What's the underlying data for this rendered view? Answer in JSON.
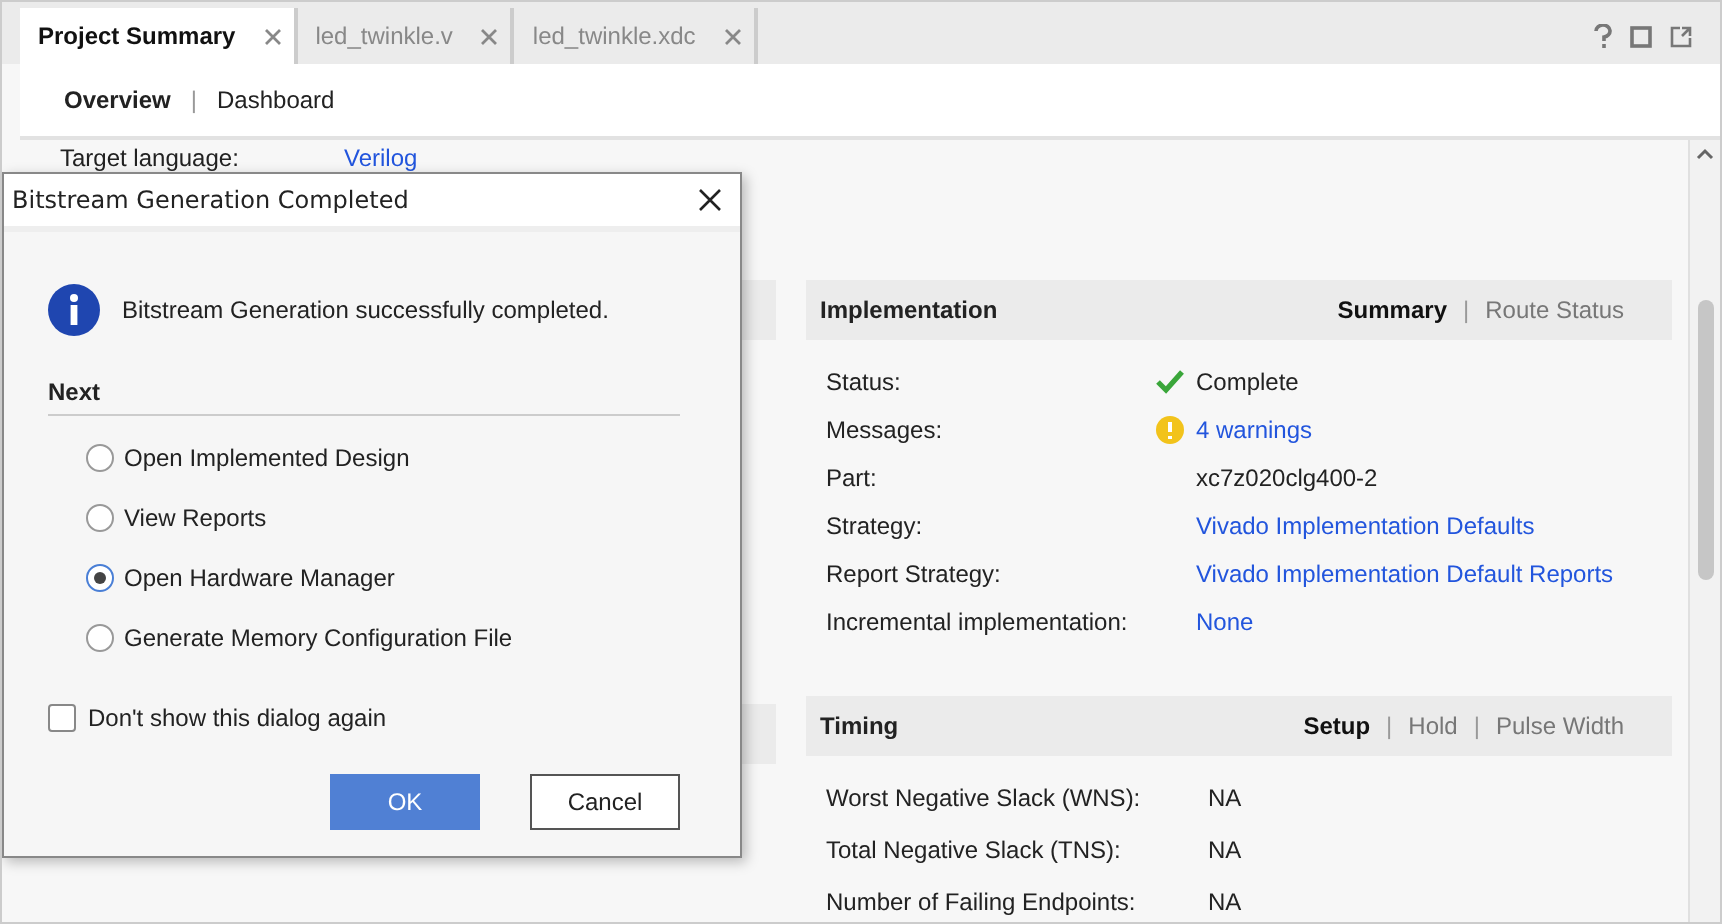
{
  "tabs": [
    {
      "label": "Project Summary",
      "selected": true
    },
    {
      "label": "led_twinkle.v",
      "selected": false
    },
    {
      "label": "led_twinkle.xdc",
      "selected": false
    }
  ],
  "sub_tabs": [
    {
      "label": "Overview",
      "selected": true
    },
    {
      "label": "Dashboard",
      "selected": false
    }
  ],
  "sub_tab_separators": [
    "|"
  ],
  "settings_row": {
    "label": "Target language:",
    "value": "Verilog"
  },
  "implementation": {
    "title": "Implementation",
    "separators": [
      "|"
    ],
    "views": [
      {
        "label": "Summary",
        "selected": true
      },
      {
        "label": "Route Status",
        "selected": false
      }
    ],
    "rows": [
      {
        "label": "Status:",
        "value": "Complete",
        "kind": "ok"
      },
      {
        "label": "Messages:",
        "value": "4 warnings",
        "kind": "warning"
      },
      {
        "label": "Part:",
        "value": "xc7z020clg400-2",
        "kind": "plain"
      },
      {
        "label": "Strategy:",
        "value": "Vivado Implementation Defaults",
        "kind": "link"
      },
      {
        "label": "Report Strategy:",
        "value": "Vivado Implementation Default Reports",
        "kind": "link"
      },
      {
        "label": "Incremental implementation:",
        "value": "None",
        "kind": "link"
      }
    ]
  },
  "timing": {
    "title": "Timing",
    "separators": [
      "|",
      "|"
    ],
    "views": [
      {
        "label": "Setup",
        "selected": true
      },
      {
        "label": "Hold",
        "selected": false
      },
      {
        "label": "Pulse Width",
        "selected": false
      }
    ],
    "rows": [
      {
        "label": "Worst Negative Slack (WNS):",
        "value": "NA"
      },
      {
        "label": "Total Negative Slack (TNS):",
        "value": "NA"
      },
      {
        "label": "Number of Failing Endpoints:",
        "value": "NA"
      }
    ]
  },
  "dialog": {
    "title": "Bitstream Generation Completed",
    "message": "Bitstream Generation successfully completed.",
    "section": "Next",
    "options": [
      {
        "label": "Open Implemented Design",
        "selected": false
      },
      {
        "label": "View Reports",
        "selected": false
      },
      {
        "label": "Open Hardware Manager",
        "selected": true
      },
      {
        "label": "Generate Memory Configuration File",
        "selected": false
      }
    ],
    "dont_show": {
      "label": "Don't show this dialog again",
      "checked": false
    },
    "buttons": [
      "OK",
      "Cancel"
    ]
  }
}
